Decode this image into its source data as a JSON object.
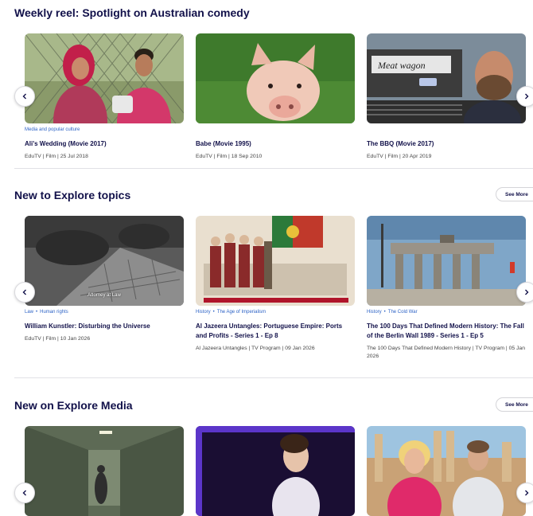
{
  "sections": [
    {
      "title": "Weekly reel: Spotlight on Australian comedy",
      "cards": [
        {
          "tags": [
            "Media and popular culture"
          ],
          "title": "Ali's Wedding (Movie 2017)",
          "meta": "EduTV | Film | 25 Jul 2018"
        },
        {
          "tags": [],
          "title": "Babe (Movie 1995)",
          "meta": "EduTV | Film | 18 Sep 2010"
        },
        {
          "tags": [],
          "title": "The BBQ (Movie 2017)",
          "meta": "EduTV | Film | 20 Apr 2019"
        }
      ]
    },
    {
      "title": "New to Explore topics",
      "see_more": "See More",
      "cards": [
        {
          "tags": [
            "Law",
            "Human rights"
          ],
          "title": "William Kunstler: Disturbing the Universe",
          "meta": "EduTV | Film | 10 Jan 2026",
          "image_caption": "Attorney at Law"
        },
        {
          "tags": [
            "History",
            "The Age of Imperialism"
          ],
          "title": "Al Jazeera Untangles: Portuguese Empire: Ports and Profits - Series 1 - Ep 8",
          "meta": "Al Jazeera Untangles | TV Program | 09 Jan 2026"
        },
        {
          "tags": [
            "History",
            "The Cold War"
          ],
          "title": "The 100 Days That Defined Modern History: The Fall of the Berlin Wall 1989 - Series 1 - Ep 5",
          "meta": "The 100 Days That Defined Modern History | TV Program | 05 Jan 2026"
        }
      ]
    },
    {
      "title": "New on Explore Media",
      "see_more": "See More",
      "cards": [
        {
          "tags": [],
          "title": "",
          "meta": ""
        },
        {
          "tags": [],
          "title": "",
          "meta": ""
        },
        {
          "tags": [],
          "title": "",
          "meta": ""
        }
      ]
    }
  ],
  "image_text": {
    "bbq_van_sign": "Meat wagon"
  },
  "icons": {
    "prev": "chevron-left-icon",
    "next": "chevron-right-icon"
  },
  "colors": {
    "heading": "#12114a",
    "tag": "#2d63c6",
    "meta": "#444444"
  }
}
